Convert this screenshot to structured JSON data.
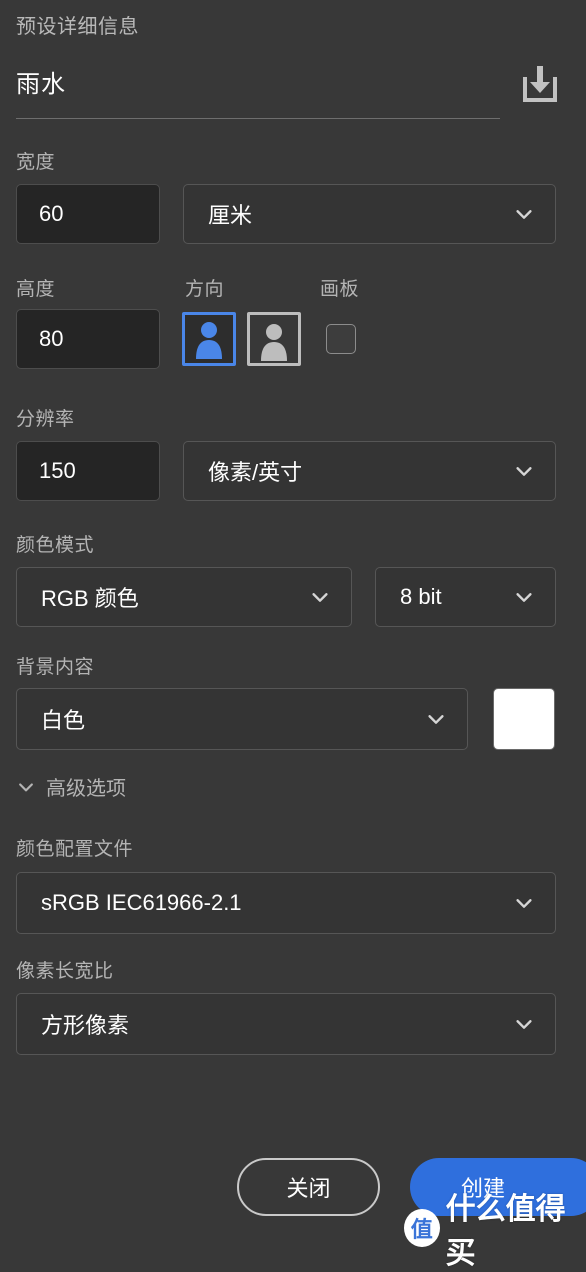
{
  "panel": {
    "title": "预设详细信息",
    "preset_name": "雨水",
    "save_preset_icon": "save-preset-icon"
  },
  "width_field": {
    "label": "宽度",
    "value": "60",
    "unit": "厘米"
  },
  "height_field": {
    "label": "高度",
    "value": "80"
  },
  "orientation": {
    "label": "方向",
    "portrait_icon": "portrait-orientation-icon",
    "landscape_icon": "landscape-orientation-icon",
    "selected": "portrait"
  },
  "artboards": {
    "label": "画板",
    "checked": false
  },
  "resolution": {
    "label": "分辨率",
    "value": "150",
    "unit": "像素/英寸"
  },
  "color_mode": {
    "label": "颜色模式",
    "mode": "RGB 颜色",
    "depth": "8 bit"
  },
  "background": {
    "label": "背景内容",
    "value": "白色",
    "swatch_color": "#FFFFFF"
  },
  "advanced": {
    "label": "高级选项",
    "expanded": true
  },
  "color_profile": {
    "label": "颜色配置文件",
    "value": "sRGB IEC61966-2.1"
  },
  "pixel_aspect": {
    "label": "像素长宽比",
    "value": "方形像素"
  },
  "footer": {
    "close_label": "关闭",
    "create_label": "创建"
  },
  "watermark": {
    "logo_text": "值",
    "text": "什么值得买"
  },
  "colors": {
    "panel_bg": "#383838",
    "input_bg": "#252525",
    "select_bg": "#343434",
    "accent_blue": "#4a86e8",
    "create_blue": "#2f6fdd",
    "label_gray": "#b4b4b4",
    "text_white": "#ffffff"
  }
}
